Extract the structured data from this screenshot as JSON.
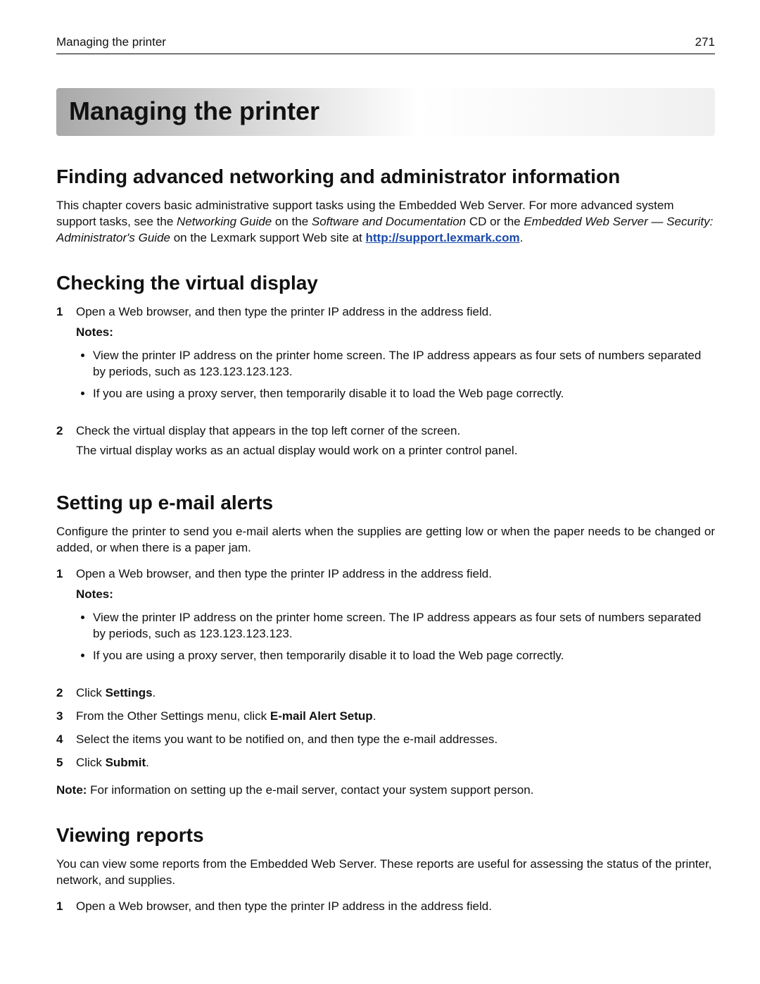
{
  "running_head": {
    "left": "Managing the printer",
    "right": "271"
  },
  "chapter_title": "Managing the printer",
  "sections": {
    "finding": {
      "heading": "Finding advanced networking and administrator information",
      "p1_a": "This chapter covers basic administrative support tasks using the Embedded Web Server. For more advanced system support tasks, see the ",
      "em1": "Networking Guide",
      "p1_b": " on the ",
      "em2": "Software and Documentation",
      "p1_c": " CD or the ",
      "em3": "Embedded Web Server — Security: Administrator's Guide",
      "p1_d": " on the Lexmark support Web site at ",
      "link_text": "http://support.lexmark.com",
      "p1_e": "."
    },
    "checking": {
      "heading": "Checking the virtual display",
      "step1": "Open a Web browser, and then type the printer IP address in the address field.",
      "notes_label": "Notes:",
      "note1": "View the printer IP address on the printer home screen. The IP address appears as four sets of numbers separated by periods, such as 123.123.123.123.",
      "note2": "If you are using a proxy server, then temporarily disable it to load the Web page correctly.",
      "step2": "Check the virtual display that appears in the top left corner of the screen.",
      "step2_sub": "The virtual display works as an actual display would work on a printer control panel."
    },
    "email": {
      "heading": "Setting up e‑mail alerts",
      "intro": "Configure the printer to send you e‑mail alerts when the supplies are getting low or when the paper needs to be changed or added, or when there is a paper jam.",
      "step1": "Open a Web browser, and then type the printer IP address in the address field.",
      "notes_label": "Notes:",
      "note1": "View the printer IP address on the printer home screen. The IP address appears as four sets of numbers separated by periods, such as 123.123.123.123.",
      "note2": "If you are using a proxy server, then temporarily disable it to load the Web page correctly.",
      "step2_a": "Click ",
      "step2_bold": "Settings",
      "step2_b": ".",
      "step3_a": "From the Other Settings menu, click ",
      "step3_bold": "E‑mail Alert Setup",
      "step3_b": ".",
      "step4": "Select the items you want to be notified on, and then type the e‑mail addresses.",
      "step5_a": "Click ",
      "step5_bold": "Submit",
      "step5_b": ".",
      "footnote_bold": "Note:",
      "footnote_text": " For information on setting up the e‑mail server, contact your system support person."
    },
    "reports": {
      "heading": "Viewing reports",
      "intro": "You can view some reports from the Embedded Web Server. These reports are useful for assessing the status of the printer, network, and supplies.",
      "step1": "Open a Web browser, and then type the printer IP address in the address field."
    }
  }
}
